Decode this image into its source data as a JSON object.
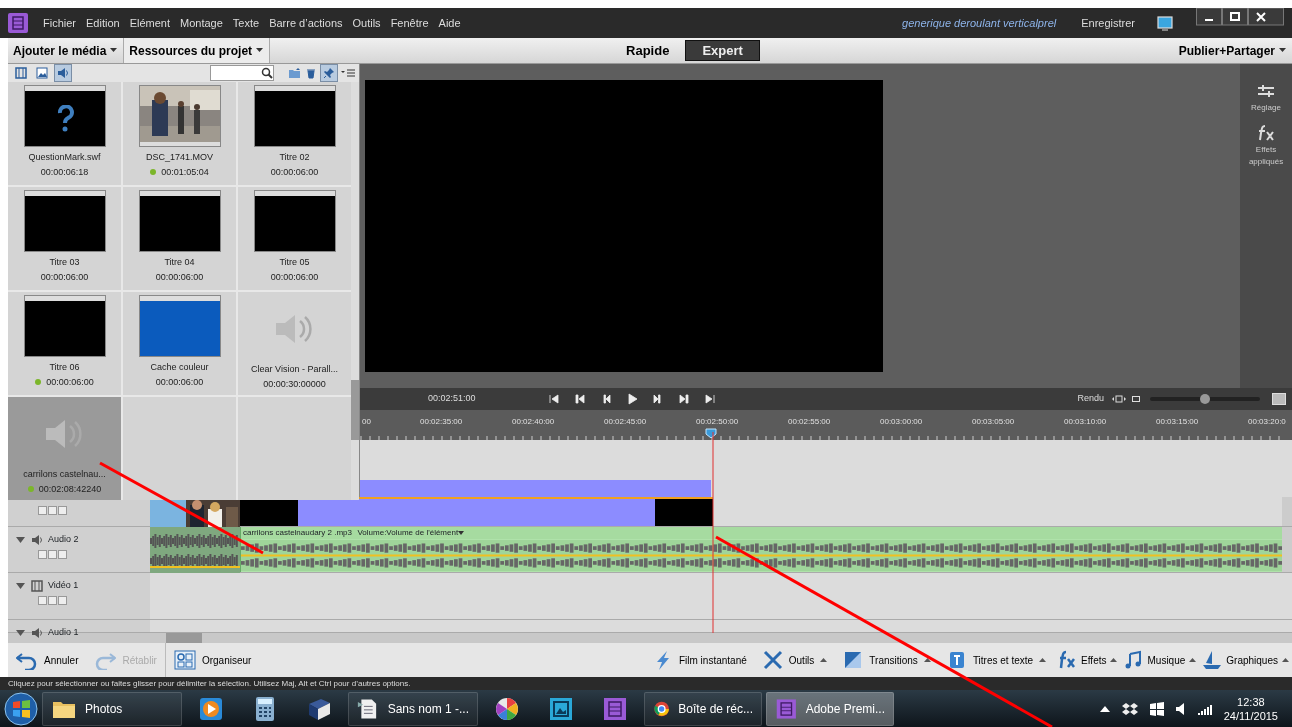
{
  "menu": [
    "Fichier",
    "Edition",
    "Elément",
    "Montage",
    "Texte",
    "Barre d’actions",
    "Outils",
    "Fenêtre",
    "Aide"
  ],
  "project_title": "generique deroulant verticalprel",
  "save_label": "Enregistrer",
  "panel_tabs": [
    {
      "label": "Ajouter le média",
      "selected": false
    },
    {
      "label": "Ressources du projet",
      "selected": true
    }
  ],
  "modes": [
    {
      "label": "Rapide",
      "selected": false
    },
    {
      "label": "Expert",
      "selected": true
    }
  ],
  "publish": "Publier+Partager",
  "filters": [
    {
      "selected": false
    },
    {
      "selected": false
    },
    {
      "selected": true
    }
  ],
  "pin_on": true,
  "media": [
    {
      "name": "QuestionMark.swf",
      "duration": "00:00:06:18",
      "kind": "question",
      "in_use": false,
      "selected": false
    },
    {
      "name": "DSC_1741.MOV",
      "duration": "00:01:05:04",
      "in_use": true,
      "selected": false
    },
    {
      "name": "Titre 02",
      "duration": "00:00:06:00",
      "kind": "black",
      "in_use": false,
      "selected": false
    },
    {
      "name": "Titre 03",
      "duration": "00:00:06:00",
      "kind": "black",
      "in_use": false,
      "selected": false
    },
    {
      "name": "Titre 04",
      "duration": "00:00:06:00",
      "kind": "black",
      "in_use": false,
      "selected": false
    },
    {
      "name": "Titre 05",
      "duration": "00:00:06:00",
      "kind": "black",
      "in_use": false,
      "selected": false
    },
    {
      "name": "Titre 06",
      "duration": "00:00:06:00",
      "kind": "black",
      "in_use": true,
      "selected": false
    },
    {
      "name": "Cache couleur",
      "duration": "00:00:06:00",
      "kind": "blue",
      "in_use": false,
      "selected": false
    },
    {
      "name": "Clear Vision - Parall...",
      "duration": "00:00:30:00000",
      "kind": "audio",
      "in_use": false,
      "selected": false
    },
    {
      "name": "carrilons castelnau...",
      "duration": "00:02:08:42240",
      "kind": "audio",
      "in_use": true,
      "selected": true
    }
  ],
  "side_panel": [
    {
      "label": "Réglage"
    },
    {
      "label": "Effets appliqués"
    }
  ],
  "transport": {
    "time": "00:02:51:00",
    "render": "Rendu",
    "zoom_slider": {
      "level": 0.45
    }
  },
  "ruler": [
    "00",
    "00:02:35:00",
    "00:02:40:00",
    "00:02:45:00",
    "00:02:50:00",
    "00:02:55:00",
    "00:03:00:00",
    "00:03:05:00",
    "00:03:10:00",
    "00:03:15:00",
    "00:03:20:0"
  ],
  "tracks": [
    {
      "kind": "video",
      "has_clip": true
    },
    {
      "kind": "audio",
      "name": "Audio 2",
      "has_clip": true
    },
    {
      "kind": "video",
      "name": "Vidéo 1"
    },
    {
      "kind": "audio",
      "name": "Audio 1"
    }
  ],
  "audio_clip": {
    "name": "carrilons castelnaudary 2 .mp3",
    "volume": "Volume:Volume de l'élément"
  },
  "toolbar_left": [
    {
      "label": "Annuler",
      "disabled": false
    },
    {
      "label": "Rétablir",
      "disabled": true
    },
    {
      "label": "Organiseur",
      "disabled": false
    }
  ],
  "toolbar_right": [
    "Film instantané",
    "Outils",
    "Transitions",
    "Titres et texte",
    "Effets",
    "Musique",
    "Graphiques"
  ],
  "status": "Cliquez pour sélectionner ou faites glisser pour délimiter la sélection. Utilisez Maj, Alt et Ctrl pour d’autres options.",
  "taskbar": [
    {
      "label": "Photos",
      "selected": false
    },
    {
      "selected": false
    },
    {
      "selected": false
    },
    {
      "selected": false
    },
    {
      "label": "Sans nom 1 -...",
      "selected": false
    },
    {
      "selected": false
    },
    {
      "selected": false
    },
    {
      "selected": false
    },
    {
      "label": "Boîte de réc...",
      "selected": false
    },
    {
      "label": "Adobe Premi...",
      "selected": true
    }
  ],
  "clock": {
    "time": "12:38",
    "date": "24/11/2015"
  }
}
